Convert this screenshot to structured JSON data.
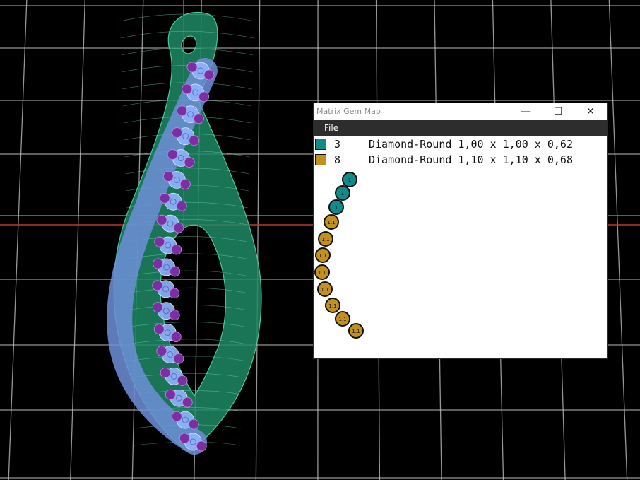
{
  "window": {
    "title": "Matrix Gem Map",
    "menu_file": "File",
    "minimize_glyph": "—",
    "maximize_glyph": "☐",
    "close_glyph": "✕"
  },
  "legend": [
    {
      "count": "3",
      "description": "Diamond-Round 1,00 x 1,00 x 0,62",
      "color": "#128a8a"
    },
    {
      "count": "8",
      "description": "Diamond-Round 1,10 x 1,10 x 0,68",
      "color": "#c2901e"
    }
  ],
  "gem_map": {
    "gems": [
      {
        "label": "1",
        "group": 0
      },
      {
        "label": "1",
        "group": 0
      },
      {
        "label": "1",
        "group": 0
      },
      {
        "label": "1.1",
        "group": 1
      },
      {
        "label": "1.1",
        "group": 1
      },
      {
        "label": "1.1",
        "group": 1
      },
      {
        "label": "1.1",
        "group": 1
      },
      {
        "label": "1.1",
        "group": 1
      },
      {
        "label": "1.1",
        "group": 1
      },
      {
        "label": "1.1",
        "group": 1
      },
      {
        "label": "1.1",
        "group": 1
      }
    ]
  },
  "scene": {
    "background": "#000000",
    "grid_color": "#c8c8c8",
    "axis_x_color": "#c0392b",
    "axis_y_color": "#1f8fb0",
    "metal_color": "#2a9d78",
    "stone_color": "#8fb4ff",
    "prong_color": "#7b2fa3"
  }
}
